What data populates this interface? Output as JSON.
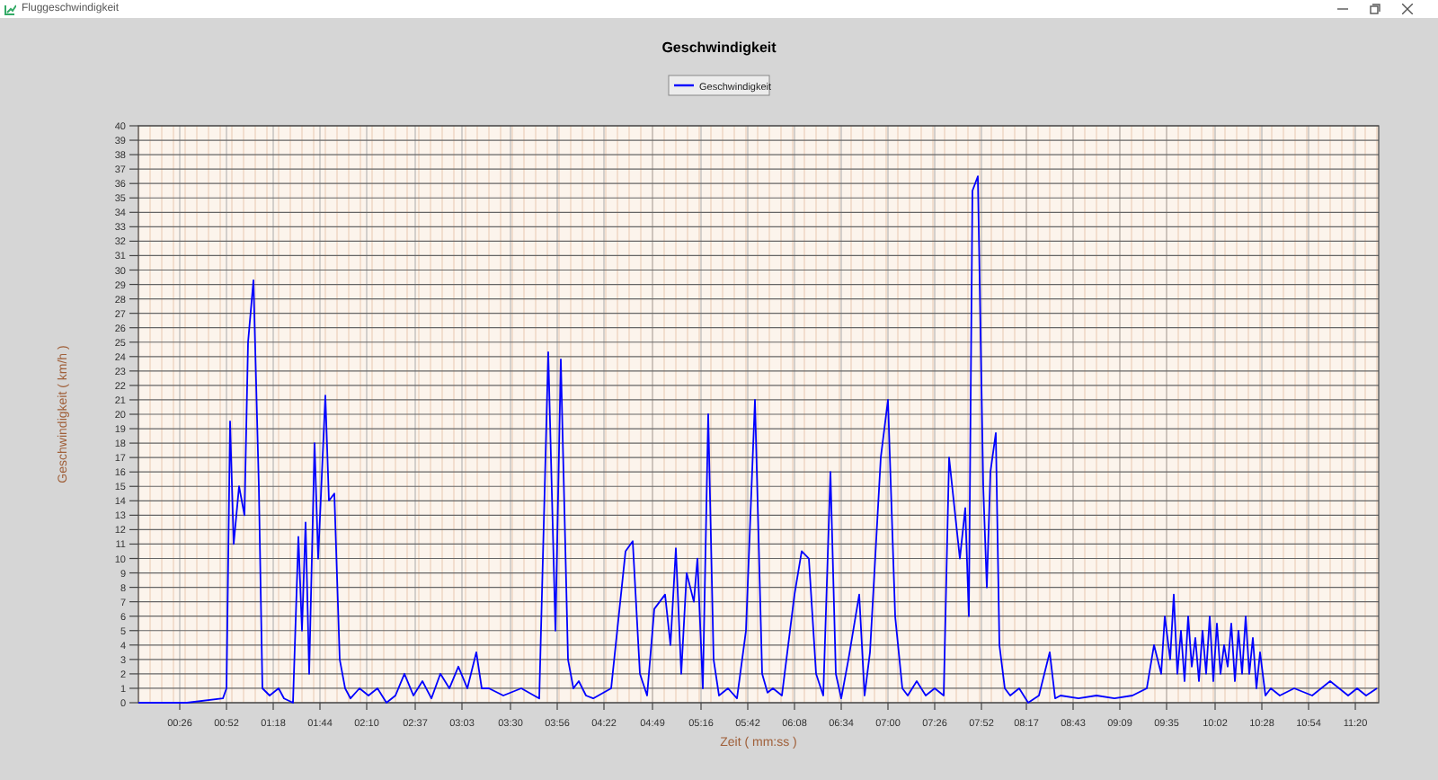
{
  "window": {
    "title": "Fluggeschwindigkeit"
  },
  "chart": {
    "chart_data": {
      "type": "line",
      "grid": true,
      "title": "Geschwindigkeit",
      "xlabel": "Zeit ( mm:ss )",
      "ylabel": "Geschwindigkeit ( km/h )",
      "xlim": [
        3,
        693
      ],
      "ylim": [
        0,
        40
      ],
      "yticks": [
        0,
        1,
        2,
        3,
        4,
        5,
        6,
        7,
        8,
        9,
        10,
        11,
        12,
        13,
        14,
        15,
        16,
        17,
        18,
        19,
        20,
        21,
        22,
        23,
        24,
        25,
        26,
        27,
        28,
        29,
        30,
        31,
        32,
        33,
        34,
        35,
        36,
        37,
        38,
        39,
        40
      ],
      "xticks": [
        {
          "value": 26,
          "label": "00:26"
        },
        {
          "value": 52,
          "label": "00:52"
        },
        {
          "value": 78,
          "label": "01:18"
        },
        {
          "value": 104,
          "label": "01:44"
        },
        {
          "value": 130,
          "label": "02:10"
        },
        {
          "value": 157,
          "label": "02:37"
        },
        {
          "value": 183,
          "label": "03:03"
        },
        {
          "value": 210,
          "label": "03:30"
        },
        {
          "value": 236,
          "label": "03:56"
        },
        {
          "value": 262,
          "label": "04:22"
        },
        {
          "value": 289,
          "label": "04:49"
        },
        {
          "value": 316,
          "label": "05:16"
        },
        {
          "value": 342,
          "label": "05:42"
        },
        {
          "value": 368,
          "label": "06:08"
        },
        {
          "value": 394,
          "label": "06:34"
        },
        {
          "value": 420,
          "label": "07:00"
        },
        {
          "value": 446,
          "label": "07:26"
        },
        {
          "value": 472,
          "label": "07:52"
        },
        {
          "value": 497,
          "label": "08:17"
        },
        {
          "value": 523,
          "label": "08:43"
        },
        {
          "value": 549,
          "label": "09:09"
        },
        {
          "value": 575,
          "label": "09:35"
        },
        {
          "value": 602,
          "label": "10:02"
        },
        {
          "value": 628,
          "label": "10:28"
        },
        {
          "value": 654,
          "label": "10:54"
        },
        {
          "value": 680,
          "label": "11:20"
        }
      ],
      "x": [
        3,
        30,
        50,
        52,
        54,
        56,
        59,
        62,
        64,
        67,
        70,
        72,
        76,
        81,
        84,
        89,
        92,
        94,
        96,
        98,
        101,
        103,
        107,
        109,
        112,
        115,
        118,
        121,
        126,
        131,
        136,
        141,
        146,
        151,
        156,
        161,
        166,
        171,
        176,
        181,
        186,
        191,
        194,
        198,
        206,
        216,
        226,
        231,
        235,
        238,
        242,
        245,
        248,
        252,
        256,
        266,
        274,
        278,
        282,
        286,
        290,
        296,
        299,
        302,
        305,
        308,
        312,
        314,
        317,
        320,
        323,
        326,
        331,
        336,
        341,
        346,
        350,
        353,
        356,
        361,
        368,
        372,
        376,
        380,
        384,
        388,
        391,
        394,
        398,
        404,
        407,
        410,
        416,
        420,
        424,
        428,
        431,
        436,
        441,
        446,
        451,
        454,
        460,
        463,
        465,
        467,
        470,
        473,
        475,
        477,
        480,
        482,
        485,
        488,
        493,
        498,
        504,
        510,
        513,
        516,
        526,
        536,
        546,
        556,
        564,
        568,
        572,
        574,
        577,
        579,
        581,
        583,
        585,
        587,
        589,
        591,
        593,
        595,
        597,
        599,
        601,
        603,
        605,
        607,
        609,
        611,
        613,
        615,
        617,
        619,
        621,
        623,
        625,
        627,
        630,
        633,
        638,
        646,
        656,
        666,
        671,
        676,
        681,
        686,
        692
      ],
      "series": [
        {
          "name": "Geschwindigkeit",
          "color": "#0000ff",
          "values": [
            0,
            0,
            0.3,
            1,
            19.5,
            11,
            15,
            13,
            25,
            29.3,
            15,
            1,
            0.5,
            1,
            0.3,
            0,
            11.5,
            5,
            12.5,
            2,
            18,
            10,
            21.3,
            14,
            14.5,
            3,
            1,
            0.3,
            1,
            0.5,
            1,
            0,
            0.5,
            2,
            0.5,
            1.5,
            0.3,
            2,
            1,
            2.5,
            1,
            3.5,
            1,
            1,
            0.5,
            1,
            0.3,
            24.3,
            5,
            23.8,
            3,
            1,
            1.5,
            0.5,
            0.3,
            1,
            10.5,
            11.2,
            2,
            0.5,
            6.5,
            7.5,
            4,
            10.7,
            2,
            9,
            7,
            10,
            1,
            20,
            3,
            0.5,
            1,
            0.3,
            5,
            21,
            2,
            0.7,
            1,
            0.5,
            7.5,
            10.5,
            10,
            2,
            0.5,
            16,
            2,
            0.3,
            3,
            7.5,
            0.5,
            3.5,
            17,
            21,
            6,
            1,
            0.5,
            1.5,
            0.5,
            1,
            0.5,
            17,
            10,
            13.5,
            6,
            35.5,
            36.5,
            15,
            8,
            16,
            18.7,
            4,
            1,
            0.5,
            1,
            0,
            0.5,
            3.5,
            0.3,
            0.5,
            0.3,
            0.5,
            0.3,
            0.5,
            1,
            4,
            2,
            6,
            3,
            7.5,
            2,
            5,
            1.5,
            6,
            2.5,
            4.5,
            1.5,
            5,
            2,
            6,
            1.5,
            5.5,
            2,
            4,
            2.5,
            5.5,
            1.5,
            5,
            2,
            6,
            2,
            4.5,
            1,
            3.5,
            0.5,
            1,
            0.5,
            1,
            0.5,
            1.5,
            1,
            0.5,
            1,
            0.5,
            1
          ]
        }
      ]
    }
  }
}
